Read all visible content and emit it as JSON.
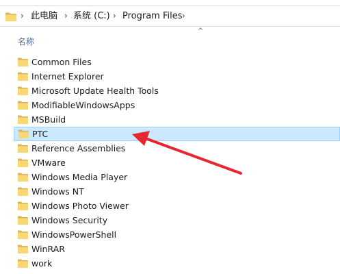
{
  "addressbar": {
    "breadcrumbs": [
      "此电脑",
      "系统 (C:)",
      "Program Files"
    ]
  },
  "header": {
    "name_column": "名称"
  },
  "files": [
    {
      "name": "Common Files"
    },
    {
      "name": "Internet Explorer"
    },
    {
      "name": "Microsoft Update Health Tools"
    },
    {
      "name": "ModifiableWindowsApps"
    },
    {
      "name": "MSBuild"
    },
    {
      "name": "PTC",
      "selected": true
    },
    {
      "name": "Reference Assemblies"
    },
    {
      "name": "VMware"
    },
    {
      "name": "Windows Media Player"
    },
    {
      "name": "Windows NT"
    },
    {
      "name": "Windows Photo Viewer"
    },
    {
      "name": "Windows Security"
    },
    {
      "name": "WindowsPowerShell"
    },
    {
      "name": "WinRAR"
    },
    {
      "name": "work"
    }
  ],
  "colors": {
    "selection_bg": "#cce8ff",
    "selection_border": "#99d1ff",
    "folder": "#f8d775",
    "annotation_arrow": "#e8262d"
  }
}
